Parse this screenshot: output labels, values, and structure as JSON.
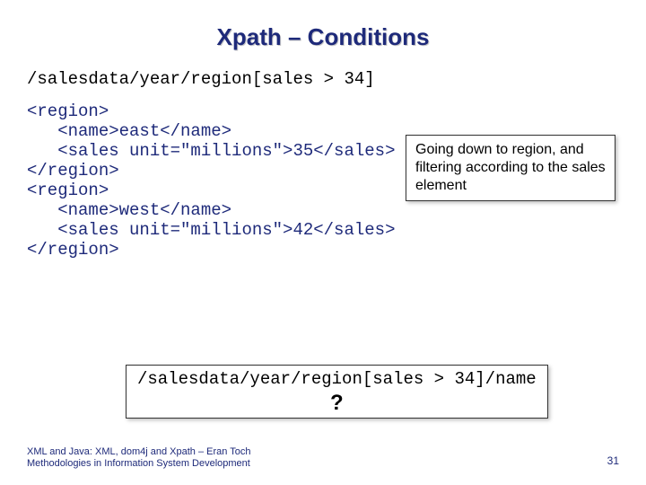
{
  "title": "Xpath – Conditions",
  "query": "/salesdata/year/region[sales > 34]",
  "xml": {
    "l1": "<region>",
    "l2": "   <name>east</name>",
    "l3": "   <sales unit=\"millions\">35</sales>",
    "l4": "</region>",
    "l5": "<region>",
    "l6": "   <name>west</name>",
    "l7": "   <sales unit=\"millions\">42</sales>",
    "l8": "</region>"
  },
  "callout1": "Going down to region, and filtering according to the sales element",
  "callout2": {
    "query": "/salesdata/year/region[sales > 34]/name",
    "mark": "?"
  },
  "footer": {
    "line1": "XML and Java: XML, dom4j and Xpath – Eran Toch",
    "line2": "Methodologies in Information System Development"
  },
  "page": "31"
}
